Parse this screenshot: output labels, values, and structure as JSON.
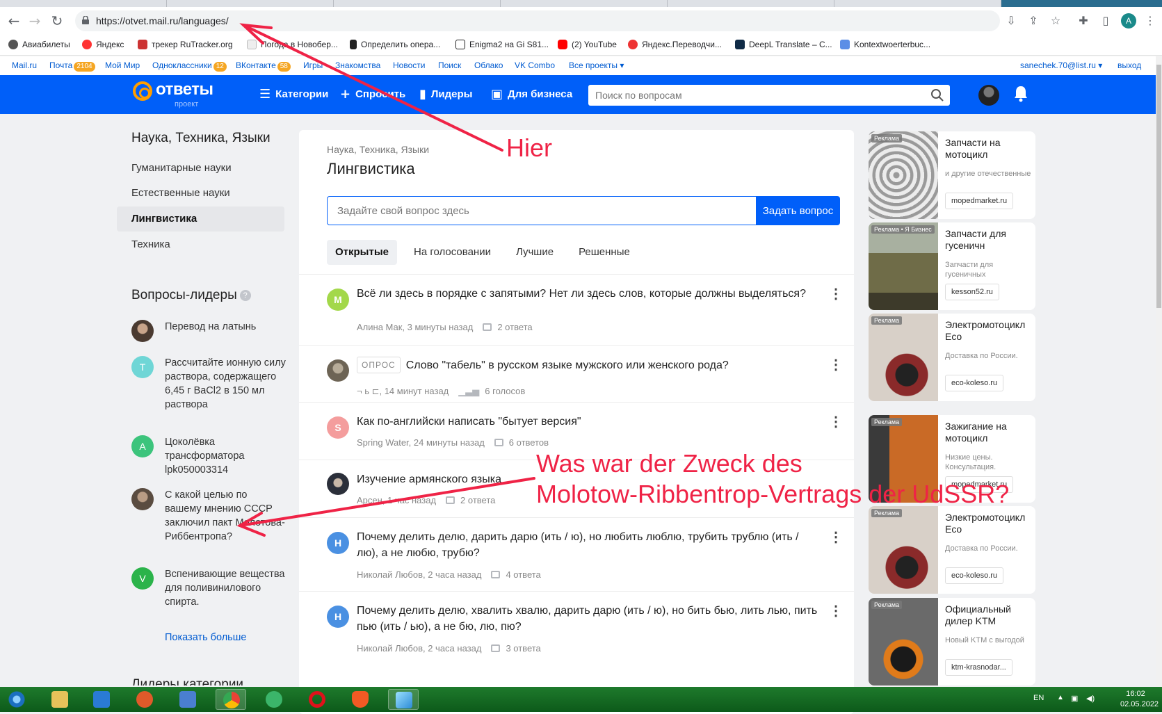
{
  "browser": {
    "url": "https://otvet.mail.ru/languages/",
    "profile_initial": "A",
    "bookmarks": [
      "Авиабилеты",
      "Яндекс",
      "трекер RuTracker.org",
      "Погода в Новобер...",
      "Определить опера...",
      "Enigma2 на Gi S81...",
      "(2) YouTube",
      "Яндекс.Переводчи...",
      "DeepL Translate – C...",
      "Kontextwoerterbuc..."
    ]
  },
  "portal": {
    "links": [
      "Mail.ru",
      "Почта",
      "Мой Мир",
      "Одноклассники",
      "ВКонтакте",
      "Игры",
      "Знакомства",
      "Новости",
      "Поиск",
      "Облако",
      "VK Combo",
      "Все проекты"
    ],
    "pochta_count": "2104",
    "ok_count": "12",
    "vk_count": "58",
    "user_email": "sanechek.70@list.ru",
    "logout": "выход"
  },
  "header": {
    "logo_text": "ответы",
    "logo_sub": "проект",
    "nav": [
      "Категории",
      "Спросить",
      "Лидеры",
      "Для бизнеса"
    ],
    "search_placeholder": "Поиск по вопросам"
  },
  "sidebar": {
    "section_title": "Наука, Техника, Языки",
    "categories": [
      "Гуманитарные науки",
      "Естественные науки",
      "Лингвистика",
      "Техника"
    ],
    "active_category": "Лингвистика",
    "leaders_title": "Вопросы-лидеры",
    "leaders": [
      {
        "initial": "",
        "text": "Перевод на латынь",
        "color": "#6b5a4e"
      },
      {
        "initial": "T",
        "text": "Рассчитайте ионную силу раствора, содержащего 6,45 г BaCl2 в 150 мл раствора",
        "color": "#6fd6d6"
      },
      {
        "initial": "A",
        "text": "Цоколёвка трансформатора lpk050003314",
        "color": "#3cc47c"
      },
      {
        "initial": "",
        "text": "С какой целью по вашему мнению СССР заключил пакт Молотова-Риббентропа?",
        "color": "#7a6a5c"
      },
      {
        "initial": "V",
        "text": "Вспенивающие вещества для поливинилового спирта.",
        "color": "#2bb34a"
      }
    ],
    "show_more": "Показать больше",
    "next_section_partial": "Лидеры категории"
  },
  "main": {
    "breadcrumb": "Наука, Техника, Языки",
    "title": "Лингвистика",
    "ask_placeholder": "Задайте свой вопрос здесь",
    "ask_button": "Задать вопрос",
    "tabs": [
      "Открытые",
      "На голосовании",
      "Лучшие",
      "Решенные"
    ],
    "active_tab": "Открытые",
    "questions": [
      {
        "initial": "M",
        "color": "#a3d84a",
        "poll": "",
        "title": "Всё ли здесь в порядке с запятыми? Нет ли здесь слов, которые должны выделяться?",
        "author": "Алина Мак, 3 минуты назад",
        "stat": "2 ответа"
      },
      {
        "initial": "",
        "color": "#8a8070",
        "poll": "ОПРОС",
        "title": "Слово \"табель\" в русском языке мужского или женского рода?",
        "author": "¬ ь ⊏, 14 минут назад",
        "stat": "6 голосов"
      },
      {
        "initial": "S",
        "color": "#f49d9d",
        "poll": "",
        "title": "Как по-английски написать \"бытует версия\"",
        "author": "Spring Water, 24 минуты назад",
        "stat": "6 ответов"
      },
      {
        "initial": "",
        "color": "#2b2f3a",
        "poll": "",
        "title": "Изучение армянского языка",
        "author": "Арсен, 1 час назад",
        "stat": "2 ответа"
      },
      {
        "initial": "H",
        "color": "#4a90e2",
        "poll": "",
        "title": "Почему делить делю, дарить дарю (ить / ю), но любить люблю, трубить трублю (ить / лю), а не любю, трубю?",
        "author": "Николай Любов, 2 часа назад",
        "stat": "4 ответа"
      },
      {
        "initial": "H",
        "color": "#4a90e2",
        "poll": "",
        "title": "Почему делить делю, хвалить хвалю, дарить дарю (ить / ю), но бить бью, лить лью, пить пью (ить / ью), а не бю, лю, пю?",
        "author": "Николай Любов, 2 часа назад",
        "stat": "3 ответа"
      }
    ]
  },
  "ads": [
    {
      "label": "Реклама",
      "title": "Запчасти на мотоцикл",
      "desc": "и другие отечественные",
      "domain": "mopedmarket.ru",
      "color": "#d9d9d9"
    },
    {
      "label": "Реклама • Я Бизнес",
      "title": "Запчасти для гусеничн",
      "desc": "Запчасти для гусеничных",
      "domain": "kesson52.ru",
      "color": "#7d7a55"
    },
    {
      "label": "Реклама",
      "title": "Электромотоцикл Eco",
      "desc": "Доставка по России.",
      "domain": "eco-koleso.ru",
      "color": "#8a3a3a"
    },
    {
      "label": "Реклама",
      "title": "Зажигание на мотоцикл",
      "desc": "Низкие цены. Консультация.",
      "domain": "mopedmarket.ru",
      "color": "#b8692c"
    },
    {
      "label": "Реклама",
      "title": "Электромотоцикл Eco",
      "desc": "Доставка по России.",
      "domain": "eco-koleso.ru",
      "color": "#8a3a3a"
    },
    {
      "label": "Реклама",
      "title": "Официальный дилер KTM",
      "desc": "Новый KTM с выгодой",
      "domain": "ktm-krasnodar...",
      "color": "#4a4a4a"
    }
  ],
  "annotations": {
    "hier": "Hier",
    "question_line1": "Was war der Zweck des",
    "question_line2": "Molotow-Ribbentrop-Vertrags der UdSSR?",
    "color": "#ef2346"
  },
  "taskbar": {
    "lang": "EN",
    "time": "16:02",
    "date": "02.05.2022"
  }
}
